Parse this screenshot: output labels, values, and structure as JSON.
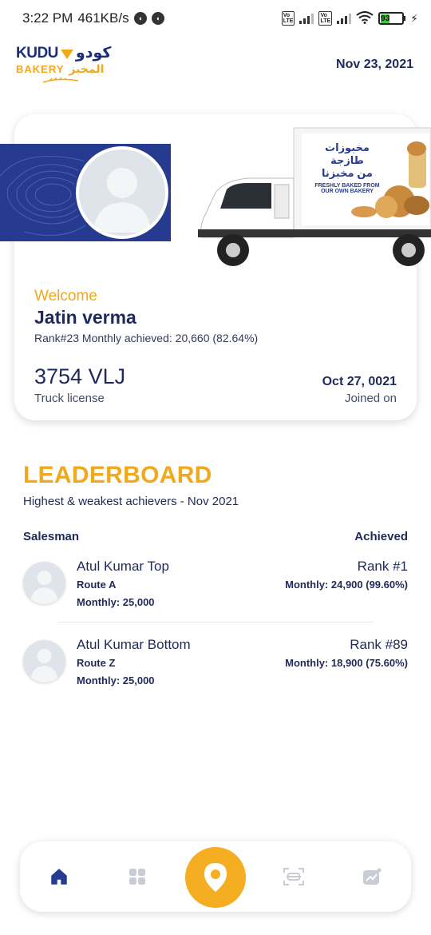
{
  "status_bar": {
    "time": "3:22 PM",
    "speed": "461KB/s",
    "battery": "93"
  },
  "header": {
    "logo": {
      "brand_latin": "KUDU",
      "brand_arabic": "كودو",
      "bakery_latin": "BAKERY",
      "bakery_arabic": "المخبز"
    },
    "date": "Nov 23, 2021"
  },
  "profile": {
    "truck_banner": {
      "arabic_line1": "مخبوزات طازجة",
      "arabic_line2": "من مخبزنا",
      "english_line1": "FRESHLY BAKED FROM",
      "english_line2": "OUR OWN BAKERY"
    },
    "welcome": "Welcome",
    "name": "Jatin verma",
    "rank_line": "Rank#23 Monthly achieved: 20,660 (82.64%)",
    "plate": "3754 VLJ",
    "plate_label": "Truck license",
    "joined_date": "Oct 27, 0021",
    "joined_label": "Joined on"
  },
  "leaderboard": {
    "title": "LEADERBOARD",
    "subtitle": "Highest & weakest achievers - Nov 2021",
    "col_salesman": "Salesman",
    "col_achieved": "Achieved",
    "entries": [
      {
        "name": "Atul Kumar Top",
        "route": "Route A",
        "monthly": "Monthly: 25,000",
        "rank": "Rank #1",
        "achieved": "Monthly: 24,900 (99.60%)"
      },
      {
        "name": "Atul Kumar Bottom",
        "route": "Route Z",
        "monthly": "Monthly: 25,000",
        "rank": "Rank #89",
        "achieved": "Monthly: 18,900 (75.60%)"
      }
    ]
  },
  "bottom_nav": {
    "items": [
      "home-icon",
      "grid-icon",
      "location-pin-icon",
      "scan-truck-icon",
      "chart-icon"
    ],
    "active": "home-icon",
    "accent": "#f5ad22"
  },
  "colors": {
    "primary_navy": "#1f2a5c",
    "brand_blue": "#263b90",
    "accent_yellow": "#f2a81d"
  }
}
